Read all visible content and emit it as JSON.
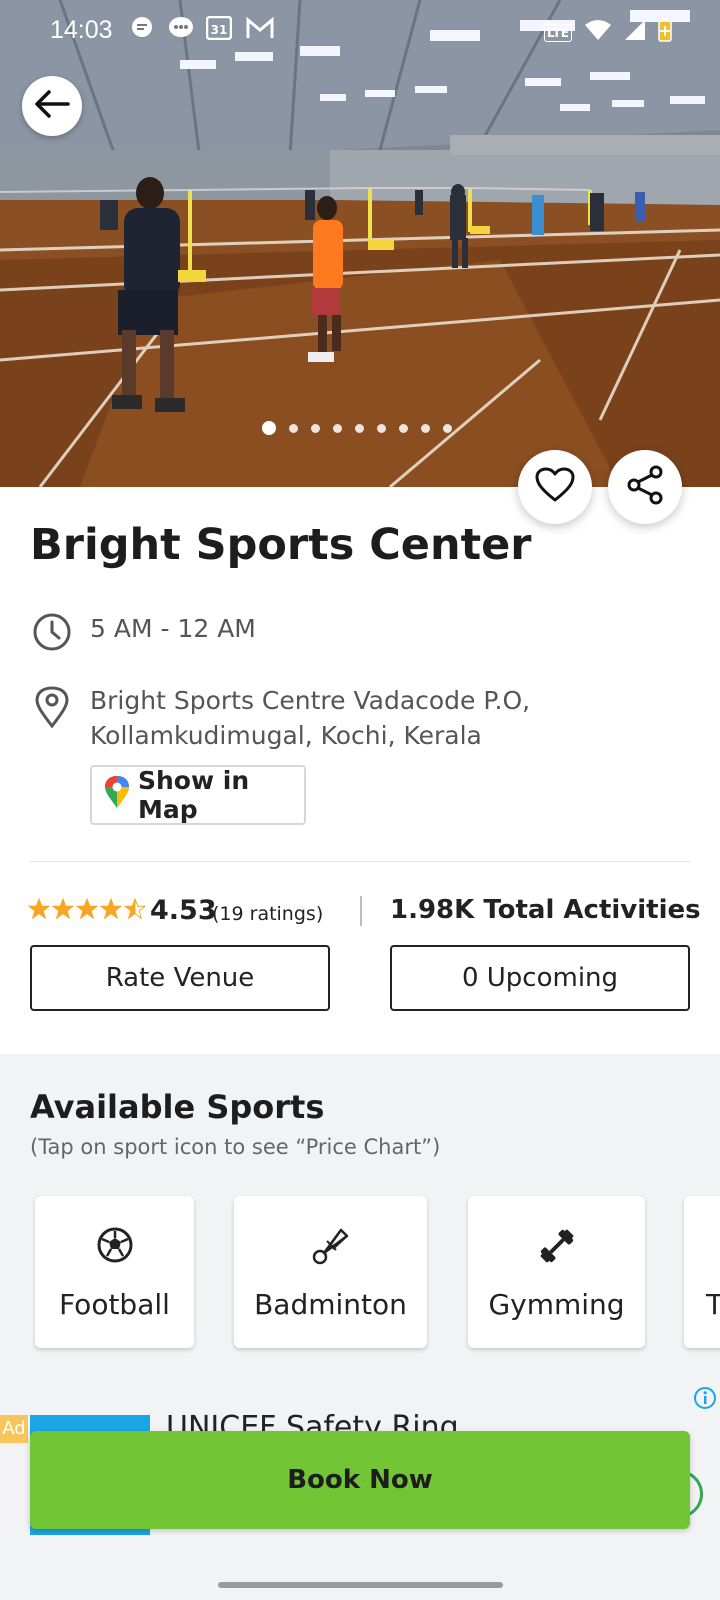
{
  "status_bar": {
    "time": "14:03",
    "left_icons": [
      "message-icon",
      "chat-icon",
      "calendar-icon",
      "gmail-icon"
    ],
    "calendar_day": "31",
    "right_icons": [
      "lte-icon",
      "wifi-icon",
      "signal-icon",
      "battery-icon"
    ],
    "network_label": "LTE"
  },
  "hero": {
    "image_description_icon": "badminton-court-photo",
    "carousel_total": 9,
    "carousel_active": 0
  },
  "venue": {
    "name": "Bright Sports Center",
    "hours": "5 AM - 12 AM",
    "address": "Bright Sports Centre  Vadacode P.O, Kollamkudimugal, Kochi, Kerala",
    "map_button": "Show in Map"
  },
  "stats": {
    "rating": "4.53",
    "ratings_count": "(19 ratings)",
    "stars_value": 4.53,
    "total_activities": "1.98K Total Activities",
    "rate_button": "Rate Venue",
    "upcoming_button": "0 Upcoming"
  },
  "sports": {
    "title": "Available Sports",
    "subtitle": "(Tap on sport icon to see “Price Chart”)",
    "items": [
      {
        "label": "Football",
        "icon": "football-icon"
      },
      {
        "label": "Badminton",
        "icon": "shuttlecock-icon"
      },
      {
        "label": "Gymming",
        "icon": "dumbbell-icon"
      },
      {
        "label": "T",
        "icon": ""
      }
    ]
  },
  "ad": {
    "badge": "Ad",
    "text": "UNICEF Safety Ring"
  },
  "actions": {
    "book_now": "Book Now"
  },
  "colors": {
    "book_button": "#72c535",
    "star": "#f5a623",
    "ad_blue": "#1aa6e6"
  }
}
